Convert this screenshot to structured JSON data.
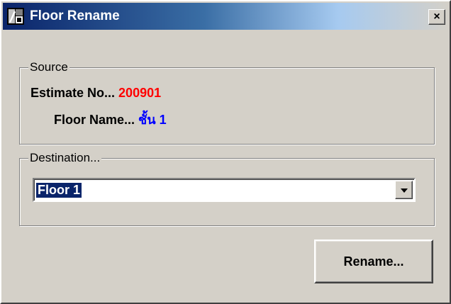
{
  "window": {
    "title": "Floor Rename",
    "close_glyph": "×",
    "icon": "floor-rename-app-icon"
  },
  "source": {
    "legend": "Source",
    "estimate_label": "Estimate No...",
    "estimate_value": "200901",
    "floor_label": "Floor Name...",
    "floor_value": "ชั้น 1"
  },
  "destination": {
    "legend": "Destination...",
    "selected_value": "Floor 1"
  },
  "actions": {
    "rename_label": "Rename..."
  },
  "colors": {
    "estimate_value": "#ff0000",
    "floor_value": "#0000ff",
    "title_bar": "#0a246a",
    "selection": "#0a246a"
  }
}
